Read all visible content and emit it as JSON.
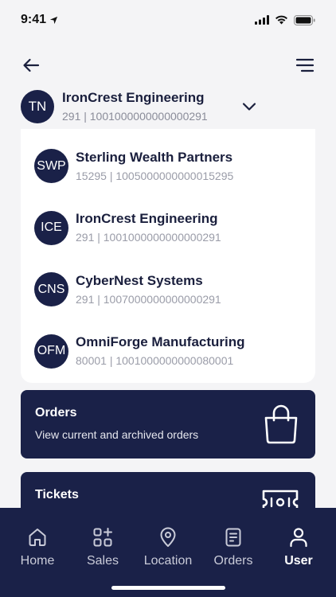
{
  "status": {
    "time": "9:41"
  },
  "current_account": {
    "initials": "TN",
    "name": "IronCrest Engineering",
    "sub": "291 | 1001000000000000291"
  },
  "accounts": [
    {
      "initials": "SWP",
      "name": "Sterling Wealth Partners",
      "sub": "15295 | 1005000000000015295"
    },
    {
      "initials": "ICE",
      "name": "IronCrest Engineering",
      "sub": "291 | 1001000000000000291"
    },
    {
      "initials": "CNS",
      "name": "CyberNest Systems",
      "sub": "291 | 1007000000000000291"
    },
    {
      "initials": "OFM",
      "name": "OmniForge Manufacturing",
      "sub": "80001 | 1001000000000080001"
    }
  ],
  "cards": {
    "orders": {
      "title": "Orders",
      "desc": "View current and archived orders",
      "icon": "shopping-bag-icon"
    },
    "tickets": {
      "title": "Tickets",
      "icon": "ticket-icon"
    }
  },
  "tabs": [
    {
      "label": "Home",
      "icon": "home-icon"
    },
    {
      "label": "Sales",
      "icon": "grid-plus-icon"
    },
    {
      "label": "Location",
      "icon": "location-pin-icon"
    },
    {
      "label": "Orders",
      "icon": "document-icon"
    },
    {
      "label": "User",
      "icon": "user-icon",
      "active": true
    }
  ],
  "colors": {
    "navy": "#1a2148",
    "background": "#f4f4f6",
    "muted_text": "#8a8c99"
  }
}
